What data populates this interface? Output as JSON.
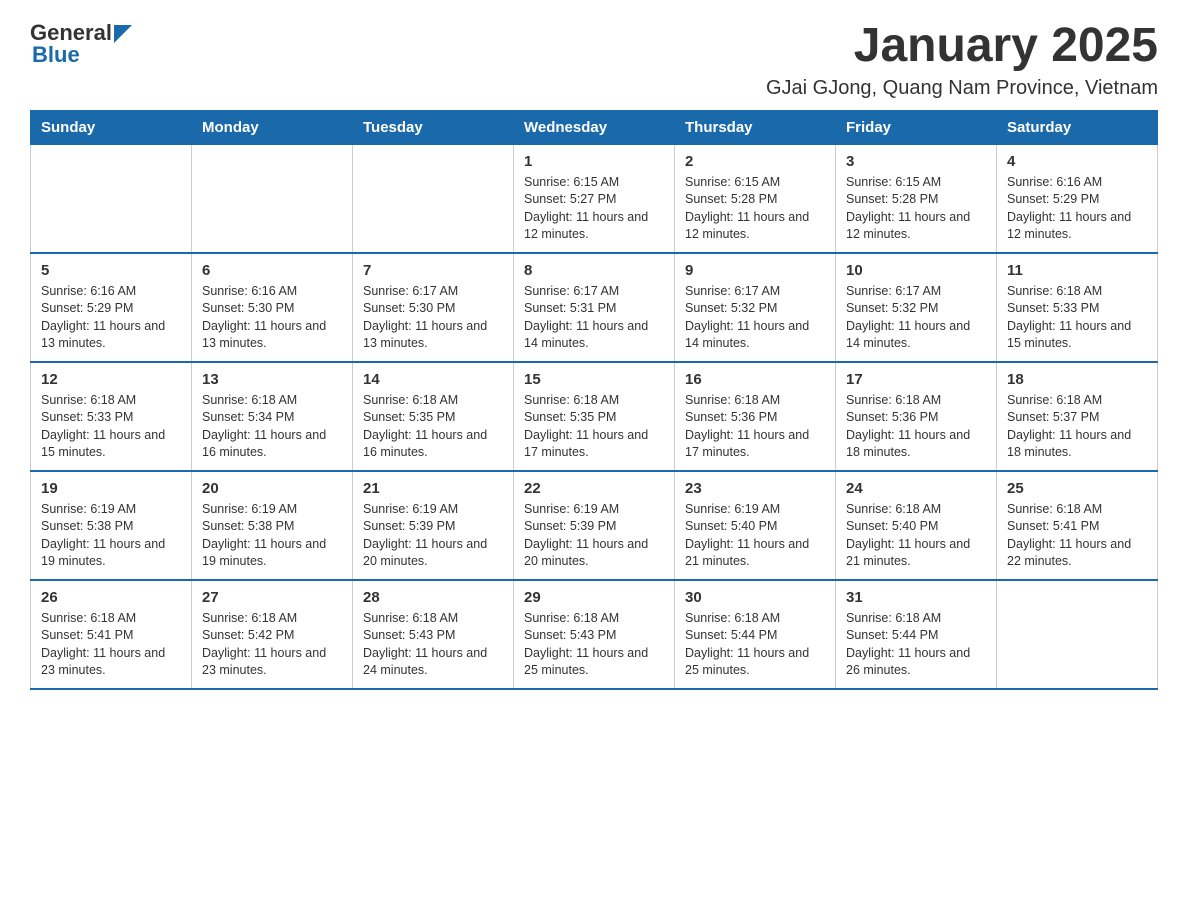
{
  "header": {
    "logo_general": "General",
    "logo_blue": "Blue",
    "title": "January 2025",
    "subtitle": "GJai GJong, Quang Nam Province, Vietnam"
  },
  "days_of_week": [
    "Sunday",
    "Monday",
    "Tuesday",
    "Wednesday",
    "Thursday",
    "Friday",
    "Saturday"
  ],
  "weeks": [
    [
      {
        "day": "",
        "sunrise": "",
        "sunset": "",
        "daylight": ""
      },
      {
        "day": "",
        "sunrise": "",
        "sunset": "",
        "daylight": ""
      },
      {
        "day": "",
        "sunrise": "",
        "sunset": "",
        "daylight": ""
      },
      {
        "day": "1",
        "sunrise": "Sunrise: 6:15 AM",
        "sunset": "Sunset: 5:27 PM",
        "daylight": "Daylight: 11 hours and 12 minutes."
      },
      {
        "day": "2",
        "sunrise": "Sunrise: 6:15 AM",
        "sunset": "Sunset: 5:28 PM",
        "daylight": "Daylight: 11 hours and 12 minutes."
      },
      {
        "day": "3",
        "sunrise": "Sunrise: 6:15 AM",
        "sunset": "Sunset: 5:28 PM",
        "daylight": "Daylight: 11 hours and 12 minutes."
      },
      {
        "day": "4",
        "sunrise": "Sunrise: 6:16 AM",
        "sunset": "Sunset: 5:29 PM",
        "daylight": "Daylight: 11 hours and 12 minutes."
      }
    ],
    [
      {
        "day": "5",
        "sunrise": "Sunrise: 6:16 AM",
        "sunset": "Sunset: 5:29 PM",
        "daylight": "Daylight: 11 hours and 13 minutes."
      },
      {
        "day": "6",
        "sunrise": "Sunrise: 6:16 AM",
        "sunset": "Sunset: 5:30 PM",
        "daylight": "Daylight: 11 hours and 13 minutes."
      },
      {
        "day": "7",
        "sunrise": "Sunrise: 6:17 AM",
        "sunset": "Sunset: 5:30 PM",
        "daylight": "Daylight: 11 hours and 13 minutes."
      },
      {
        "day": "8",
        "sunrise": "Sunrise: 6:17 AM",
        "sunset": "Sunset: 5:31 PM",
        "daylight": "Daylight: 11 hours and 14 minutes."
      },
      {
        "day": "9",
        "sunrise": "Sunrise: 6:17 AM",
        "sunset": "Sunset: 5:32 PM",
        "daylight": "Daylight: 11 hours and 14 minutes."
      },
      {
        "day": "10",
        "sunrise": "Sunrise: 6:17 AM",
        "sunset": "Sunset: 5:32 PM",
        "daylight": "Daylight: 11 hours and 14 minutes."
      },
      {
        "day": "11",
        "sunrise": "Sunrise: 6:18 AM",
        "sunset": "Sunset: 5:33 PM",
        "daylight": "Daylight: 11 hours and 15 minutes."
      }
    ],
    [
      {
        "day": "12",
        "sunrise": "Sunrise: 6:18 AM",
        "sunset": "Sunset: 5:33 PM",
        "daylight": "Daylight: 11 hours and 15 minutes."
      },
      {
        "day": "13",
        "sunrise": "Sunrise: 6:18 AM",
        "sunset": "Sunset: 5:34 PM",
        "daylight": "Daylight: 11 hours and 16 minutes."
      },
      {
        "day": "14",
        "sunrise": "Sunrise: 6:18 AM",
        "sunset": "Sunset: 5:35 PM",
        "daylight": "Daylight: 11 hours and 16 minutes."
      },
      {
        "day": "15",
        "sunrise": "Sunrise: 6:18 AM",
        "sunset": "Sunset: 5:35 PM",
        "daylight": "Daylight: 11 hours and 17 minutes."
      },
      {
        "day": "16",
        "sunrise": "Sunrise: 6:18 AM",
        "sunset": "Sunset: 5:36 PM",
        "daylight": "Daylight: 11 hours and 17 minutes."
      },
      {
        "day": "17",
        "sunrise": "Sunrise: 6:18 AM",
        "sunset": "Sunset: 5:36 PM",
        "daylight": "Daylight: 11 hours and 18 minutes."
      },
      {
        "day": "18",
        "sunrise": "Sunrise: 6:18 AM",
        "sunset": "Sunset: 5:37 PM",
        "daylight": "Daylight: 11 hours and 18 minutes."
      }
    ],
    [
      {
        "day": "19",
        "sunrise": "Sunrise: 6:19 AM",
        "sunset": "Sunset: 5:38 PM",
        "daylight": "Daylight: 11 hours and 19 minutes."
      },
      {
        "day": "20",
        "sunrise": "Sunrise: 6:19 AM",
        "sunset": "Sunset: 5:38 PM",
        "daylight": "Daylight: 11 hours and 19 minutes."
      },
      {
        "day": "21",
        "sunrise": "Sunrise: 6:19 AM",
        "sunset": "Sunset: 5:39 PM",
        "daylight": "Daylight: 11 hours and 20 minutes."
      },
      {
        "day": "22",
        "sunrise": "Sunrise: 6:19 AM",
        "sunset": "Sunset: 5:39 PM",
        "daylight": "Daylight: 11 hours and 20 minutes."
      },
      {
        "day": "23",
        "sunrise": "Sunrise: 6:19 AM",
        "sunset": "Sunset: 5:40 PM",
        "daylight": "Daylight: 11 hours and 21 minutes."
      },
      {
        "day": "24",
        "sunrise": "Sunrise: 6:18 AM",
        "sunset": "Sunset: 5:40 PM",
        "daylight": "Daylight: 11 hours and 21 minutes."
      },
      {
        "day": "25",
        "sunrise": "Sunrise: 6:18 AM",
        "sunset": "Sunset: 5:41 PM",
        "daylight": "Daylight: 11 hours and 22 minutes."
      }
    ],
    [
      {
        "day": "26",
        "sunrise": "Sunrise: 6:18 AM",
        "sunset": "Sunset: 5:41 PM",
        "daylight": "Daylight: 11 hours and 23 minutes."
      },
      {
        "day": "27",
        "sunrise": "Sunrise: 6:18 AM",
        "sunset": "Sunset: 5:42 PM",
        "daylight": "Daylight: 11 hours and 23 minutes."
      },
      {
        "day": "28",
        "sunrise": "Sunrise: 6:18 AM",
        "sunset": "Sunset: 5:43 PM",
        "daylight": "Daylight: 11 hours and 24 minutes."
      },
      {
        "day": "29",
        "sunrise": "Sunrise: 6:18 AM",
        "sunset": "Sunset: 5:43 PM",
        "daylight": "Daylight: 11 hours and 25 minutes."
      },
      {
        "day": "30",
        "sunrise": "Sunrise: 6:18 AM",
        "sunset": "Sunset: 5:44 PM",
        "daylight": "Daylight: 11 hours and 25 minutes."
      },
      {
        "day": "31",
        "sunrise": "Sunrise: 6:18 AM",
        "sunset": "Sunset: 5:44 PM",
        "daylight": "Daylight: 11 hours and 26 minutes."
      },
      {
        "day": "",
        "sunrise": "",
        "sunset": "",
        "daylight": ""
      }
    ]
  ]
}
